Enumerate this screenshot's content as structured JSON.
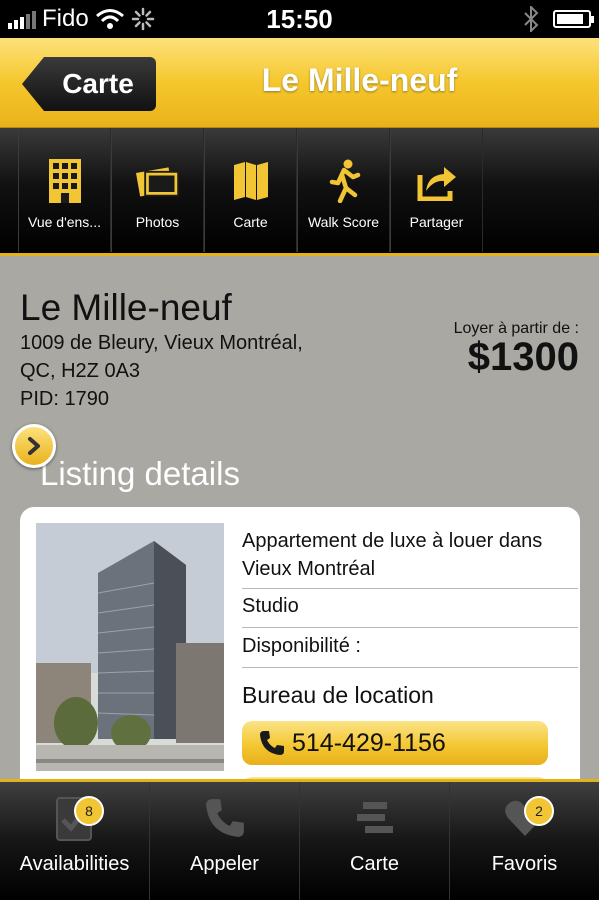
{
  "status_bar": {
    "carrier": "Fido",
    "time": "15:50"
  },
  "header": {
    "back_label": "Carte",
    "title": "Le Mille-neuf"
  },
  "toolbar": {
    "items": [
      {
        "label": "Vue d'ens...",
        "icon": "building-icon"
      },
      {
        "label": "Photos",
        "icon": "photos-icon"
      },
      {
        "label": "Carte",
        "icon": "map-icon"
      },
      {
        "label": "Walk Score",
        "icon": "walking-person-icon"
      },
      {
        "label": "Partager",
        "icon": "share-icon"
      }
    ]
  },
  "property": {
    "name": "Le Mille-neuf",
    "address_line1": "1009 de Bleury, Vieux Montréal,",
    "address_line2": "QC, H2Z 0A3",
    "pid": "PID: 1790",
    "rent_label": "Loyer à partir de :",
    "rent_price": "$1300"
  },
  "listing": {
    "section_title": "Listing details",
    "description": "Appartement de luxe à louer dans Vieux Montréal",
    "type": "Studio",
    "availability": "Disponibilité :",
    "office_label": "Bureau de location",
    "phone": "514-429-1156"
  },
  "tabbar": {
    "items": [
      {
        "label": "Availabilities",
        "icon": "checklist-icon",
        "badge": "8"
      },
      {
        "label": "Appeler",
        "icon": "phone-icon",
        "badge": ""
      },
      {
        "label": "Carte",
        "icon": "map-list-icon",
        "badge": ""
      },
      {
        "label": "Favoris",
        "icon": "heart-icon",
        "badge": "2"
      }
    ]
  },
  "colors": {
    "accent": "#f2c534",
    "background": "#a9a8a3",
    "bar": "#000000"
  }
}
